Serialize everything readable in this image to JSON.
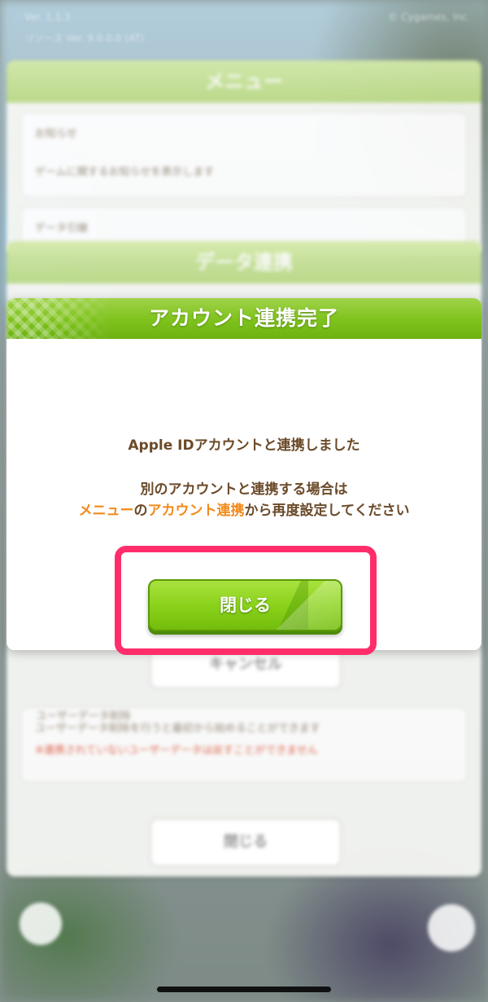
{
  "background": {
    "version_text": "Ver. 1.1.3",
    "resource_text": "リソース Ver. 9.0.0.0 (AT)",
    "copyright_text": "© Cygames, Inc.",
    "menu_title": "メニュー",
    "notice_title": "お知らせ",
    "notice_desc": "ゲームに関するお知らせを表示します",
    "data_title": "データ引継",
    "data_link_title": "データ連携",
    "cancel_label": "キャンセル",
    "user_data_title": "ユーザーデータ削除",
    "user_data_desc": "ユーザーデータ削除を行うと最初から始めることができます",
    "user_data_warning": "※連携されていないユーザーデータは戻すことができません",
    "bg_close_label": "閉じる"
  },
  "modal": {
    "title": "アカウント連携完了",
    "message_line1": "Apple IDアカウントと連携しました",
    "message_line2": "別のアカウントと連携する場合は",
    "message_line3": {
      "part1": "メニュー",
      "part2": "の",
      "part3": "アカウント連携",
      "part4": "から再度設定してください"
    },
    "close_label": "閉じる"
  },
  "colors": {
    "accent_green": "#7ec21c",
    "text_brown": "#6b4a2a",
    "highlight_orange": "#f28a1a",
    "annotation_pink": "#ff2e6b"
  }
}
